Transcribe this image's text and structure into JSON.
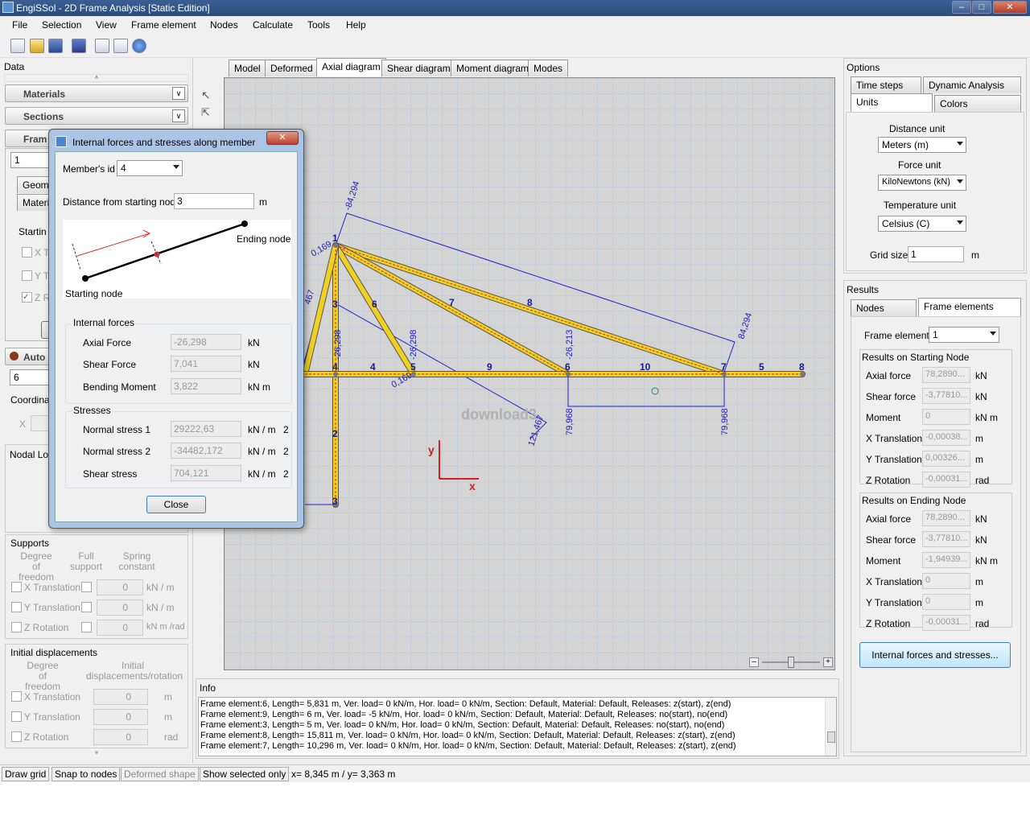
{
  "window": {
    "title": "EngiSSol - 2D Frame Analysis [Static Edition]"
  },
  "menu": [
    "File",
    "Selection",
    "View",
    "Frame element",
    "Nodes",
    "Calculate",
    "Tools",
    "Help"
  ],
  "left": {
    "data_label": "Data",
    "materials": "Materials",
    "sections": "Sections",
    "frame": "Fram",
    "frame_id": "1",
    "geome_tab": "Geome",
    "materia_tab": "Materia",
    "starting": "Startin",
    "x_t": "X T",
    "y_t": "Y T",
    "z_r": "Z R",
    "auto": "Auto",
    "auto_value": "6",
    "coordina": "Coordinat",
    "coord_x": "X",
    "nodal_loa": "Nodal Loa",
    "supports": {
      "title": "Supports",
      "col1": "Degree of freedom",
      "col2": "Full support",
      "col3": "Spring constant",
      "rows": [
        {
          "label": "X Translation",
          "value": "0",
          "unit": "kN / m"
        },
        {
          "label": "Y Translation",
          "value": "0",
          "unit": "kN / m"
        },
        {
          "label": "Z Rotation",
          "value": "0",
          "unit": "kN m /rad"
        }
      ]
    },
    "initial": {
      "title": "Initial displacements",
      "col1": "Degree of freedom",
      "col2": "Initial displacements/rotation",
      "rows": [
        {
          "label": "X Translation",
          "value": "0",
          "unit": "m"
        },
        {
          "label": "Y Translation",
          "value": "0",
          "unit": "m"
        },
        {
          "label": "Z Rotation",
          "value": "0",
          "unit": "rad"
        }
      ]
    }
  },
  "tabs": [
    "Model",
    "Deformed",
    "Axial diagram",
    "Shear diagram",
    "Moment diagram",
    "Modes"
  ],
  "active_tab": "Axial diagram",
  "diagram": {
    "node_labels": [
      "1",
      "3",
      "4",
      "5",
      "6",
      "7",
      "8",
      "1",
      "2",
      "3"
    ],
    "member_labels": [
      "4",
      "9",
      "10",
      "5",
      "6",
      "7",
      "8"
    ],
    "values": [
      "-84,294",
      "0,169",
      "-26,298",
      "-26,298",
      "-26,213",
      "84,294",
      "0,169",
      "121,467",
      "79,968",
      "79,968",
      "467"
    ],
    "axis_x": "x",
    "axis_y": "y",
    "watermark": "download3"
  },
  "dialog": {
    "title": "Internal forces and stresses along member",
    "member_id_label": "Member's id",
    "member_id": "4",
    "distance_label": "Distance from starting node",
    "distance": "3",
    "distance_unit": "m",
    "ending_node": "Ending node",
    "starting_node": "Starting node",
    "internal_forces": "Internal forces",
    "axial_label": "Axial Force",
    "axial": "-26,298",
    "axial_unit": "kN",
    "shear_label": "Shear Force",
    "shear": "7,041",
    "shear_unit": "kN",
    "moment_label": "Bending Moment",
    "moment": "3,822",
    "moment_unit": "kN m",
    "stresses": "Stresses",
    "ns1_label": "Normal stress 1",
    "ns1": "29222,63",
    "ns2_label": "Normal stress 2",
    "ns2": "-34482,172",
    "ss_label": "Shear stress",
    "ss": "704,121",
    "stress_unit": "kN / m",
    "stress_exp": "2",
    "close": "Close"
  },
  "options": {
    "title": "Options",
    "tabs": [
      "Time steps",
      "Dynamic Analysis",
      "Units",
      "Colors"
    ],
    "distance_unit_label": "Distance unit",
    "distance_unit": "Meters (m)",
    "force_unit_label": "Force unit",
    "force_unit": "KiloNewtons (kN)",
    "temp_unit_label": "Temperature unit",
    "temp_unit": "Celsius (C)",
    "grid_label": "Grid size",
    "grid": "1",
    "grid_unit": "m"
  },
  "results": {
    "title": "Results",
    "tabs": [
      "Nodes",
      "Frame elements"
    ],
    "fe_label": "Frame element",
    "fe": "1",
    "start_title": "Results on Starting Node",
    "start": [
      {
        "label": "Axial force",
        "value": "78,2890...",
        "unit": "kN"
      },
      {
        "label": "Shear force",
        "value": "-3,77810...",
        "unit": "kN"
      },
      {
        "label": "Moment",
        "value": "0",
        "unit": "kN m"
      },
      {
        "label": "X Translation",
        "value": "-0,00038...",
        "unit": "m"
      },
      {
        "label": "Y Translation",
        "value": "0,00326...",
        "unit": "m"
      },
      {
        "label": "Z Rotation",
        "value": "-0,00031...",
        "unit": "rad"
      }
    ],
    "end_title": "Results on Ending Node",
    "end": [
      {
        "label": "Axial force",
        "value": "78,2890...",
        "unit": "kN"
      },
      {
        "label": "Shear force",
        "value": "-3,77810...",
        "unit": "kN"
      },
      {
        "label": "Moment",
        "value": "-1,94939...",
        "unit": "kN m"
      },
      {
        "label": "X Translation",
        "value": "0",
        "unit": "m"
      },
      {
        "label": "Y Translation",
        "value": "0",
        "unit": "m"
      },
      {
        "label": "Z Rotation",
        "value": "-0,00031...",
        "unit": "rad"
      }
    ],
    "button": "Internal forces and stresses..."
  },
  "info": {
    "title": "Info",
    "lines": [
      "Frame element:6, Length= 5,831 m, Ver. load= 0 kN/m, Hor. load= 0 kN/m, Section: Default, Material: Default, Releases: z(start), z(end)",
      "Frame element:9, Length= 6 m, Ver. load= -5 kN/m, Hor. load= 0 kN/m, Section: Default, Material: Default, Releases: no(start), no(end)",
      "Frame element:3, Length= 5 m, Ver. load= 0 kN/m, Hor. load= 0 kN/m, Section: Default, Material: Default, Releases: no(start), no(end)",
      "Frame element:8, Length= 15,811 m, Ver. load= 0 kN/m, Hor. load= 0 kN/m, Section: Default, Material: Default, Releases: z(start), z(end)",
      "Frame element:7, Length= 10,296 m, Ver. load= 0 kN/m, Hor. load= 0 kN/m, Section: Default, Material: Default, Releases: z(start), z(end)"
    ]
  },
  "status": {
    "draw_grid": "Draw grid",
    "snap": "Snap to nodes",
    "deformed": "Deformed shape",
    "show_selected": "Show selected only",
    "coords": "x= 8,345 m / y= 3,363 m"
  }
}
